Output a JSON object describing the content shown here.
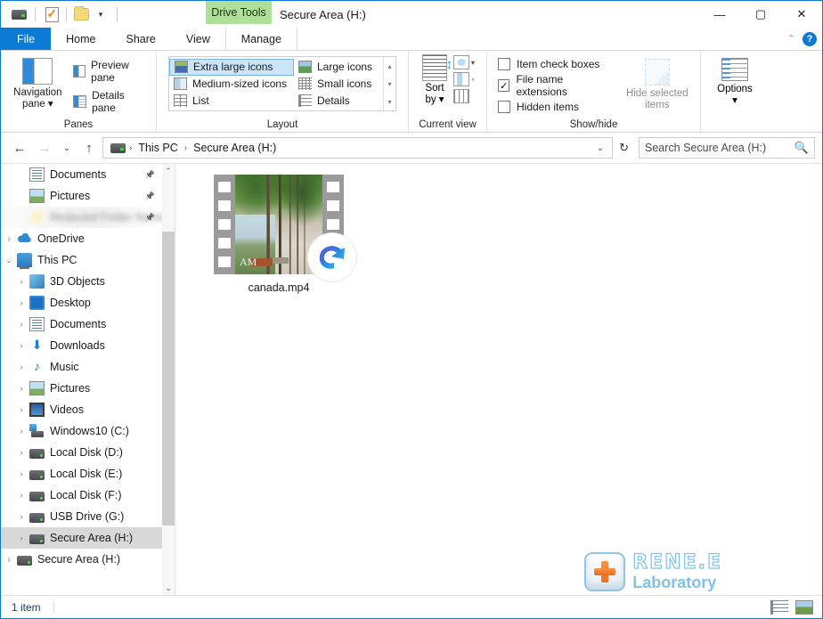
{
  "window": {
    "title": "Secure Area (H:)",
    "contextual_tab_group": "Drive Tools",
    "minimize_label": "—",
    "maximize_label": "▢",
    "close_label": "✕",
    "collapse_ribbon_label": "⌃",
    "help_label": "?"
  },
  "quick_access": {
    "items": [
      {
        "name": "drive-icon",
        "label": "Drive"
      },
      {
        "name": "properties-icon",
        "label": "Properties"
      },
      {
        "name": "new-folder-icon",
        "label": "New folder"
      },
      {
        "name": "customize-caret",
        "label": "▾"
      }
    ]
  },
  "tabs": [
    {
      "id": "file",
      "label": "File"
    },
    {
      "id": "home",
      "label": "Home"
    },
    {
      "id": "share",
      "label": "Share"
    },
    {
      "id": "view",
      "label": "View"
    },
    {
      "id": "manage",
      "label": "Manage"
    }
  ],
  "ribbon": {
    "panes": {
      "group_label": "Panes",
      "navigation_pane": "Navigation\npane",
      "navigation_pane_line1": "Navigation",
      "navigation_pane_line2": "pane ▾",
      "preview_pane": "Preview pane",
      "details_pane": "Details pane"
    },
    "layout": {
      "group_label": "Layout",
      "options": [
        {
          "label": "Extra large icons",
          "selected": true
        },
        {
          "label": "Large icons",
          "selected": false
        },
        {
          "label": "Medium-sized icons",
          "selected": false
        },
        {
          "label": "Small icons",
          "selected": false
        },
        {
          "label": "List",
          "selected": false
        },
        {
          "label": "Details",
          "selected": false
        }
      ],
      "scroll_up": "▴",
      "scroll_down": "▾",
      "expand": "▾"
    },
    "current_view": {
      "group_label": "Current view",
      "sort_by_line1": "Sort",
      "sort_by_line2": "by ▾",
      "group_by_caret": "▾",
      "add_columns_caret": "▾",
      "size_columns_caret": "▾"
    },
    "show_hide": {
      "group_label": "Show/hide",
      "checkboxes": [
        {
          "label": "Item check boxes",
          "checked": false
        },
        {
          "label": "File name extensions",
          "checked": true
        },
        {
          "label": "Hidden items",
          "checked": false
        }
      ],
      "hide_selected_line1": "Hide selected",
      "hide_selected_line2": "items"
    },
    "options": {
      "label": "Options",
      "caret": "▾"
    }
  },
  "addressbar": {
    "back": "←",
    "forward": "→",
    "recent": "⌄",
    "up": "↑",
    "breadcrumbs": [
      "This PC",
      "Secure Area (H:)"
    ],
    "separator": "›",
    "dropdown": "⌄",
    "refresh": "↻"
  },
  "search": {
    "placeholder": "Search Secure Area (H:)",
    "icon": "search-icon"
  },
  "navpane": {
    "items": [
      {
        "label": "Documents",
        "icon": "document-icon",
        "indent": 1,
        "expander": "",
        "pinned": true,
        "selected": false,
        "blurred": false
      },
      {
        "label": "Pictures",
        "icon": "picture-icon",
        "indent": 1,
        "expander": "",
        "pinned": true,
        "selected": false,
        "blurred": false
      },
      {
        "label": "Redacted Folder Name",
        "icon": "sun-icon",
        "indent": 1,
        "expander": "",
        "pinned": true,
        "selected": false,
        "blurred": true
      },
      {
        "label": "OneDrive",
        "icon": "onedrive-icon",
        "indent": 0,
        "expander": "›",
        "pinned": false,
        "selected": false,
        "blurred": false
      },
      {
        "label": "This PC",
        "icon": "this-pc-icon",
        "indent": 0,
        "expander": "⌄",
        "pinned": false,
        "selected": false,
        "blurred": false
      },
      {
        "label": "3D Objects",
        "icon": "3d-objects-icon",
        "indent": 1,
        "expander": "›",
        "pinned": false,
        "selected": false,
        "blurred": false
      },
      {
        "label": "Desktop",
        "icon": "desktop-icon",
        "indent": 1,
        "expander": "›",
        "pinned": false,
        "selected": false,
        "blurred": false
      },
      {
        "label": "Documents",
        "icon": "document-icon",
        "indent": 1,
        "expander": "›",
        "pinned": false,
        "selected": false,
        "blurred": false
      },
      {
        "label": "Downloads",
        "icon": "downloads-icon",
        "indent": 1,
        "expander": "›",
        "pinned": false,
        "selected": false,
        "blurred": false
      },
      {
        "label": "Music",
        "icon": "music-icon",
        "indent": 1,
        "expander": "›",
        "pinned": false,
        "selected": false,
        "blurred": false
      },
      {
        "label": "Pictures",
        "icon": "picture-icon",
        "indent": 1,
        "expander": "›",
        "pinned": false,
        "selected": false,
        "blurred": false
      },
      {
        "label": "Videos",
        "icon": "videos-icon",
        "indent": 1,
        "expander": "›",
        "pinned": false,
        "selected": false,
        "blurred": false
      },
      {
        "label": "Windows10 (C:)",
        "icon": "windows-drive-icon",
        "indent": 1,
        "expander": "›",
        "pinned": false,
        "selected": false,
        "blurred": false
      },
      {
        "label": "Local Disk (D:)",
        "icon": "drive-icon",
        "indent": 1,
        "expander": "›",
        "pinned": false,
        "selected": false,
        "blurred": false
      },
      {
        "label": "Local Disk (E:)",
        "icon": "drive-icon",
        "indent": 1,
        "expander": "›",
        "pinned": false,
        "selected": false,
        "blurred": false
      },
      {
        "label": "Local Disk (F:)",
        "icon": "drive-icon",
        "indent": 1,
        "expander": "›",
        "pinned": false,
        "selected": false,
        "blurred": false
      },
      {
        "label": "USB Drive (G:)",
        "icon": "drive-icon",
        "indent": 1,
        "expander": "›",
        "pinned": false,
        "selected": false,
        "blurred": false
      },
      {
        "label": "Secure Area (H:)",
        "icon": "drive-icon",
        "indent": 1,
        "expander": "›",
        "pinned": false,
        "selected": true,
        "blurred": false
      },
      {
        "label": "Secure Area (H:)",
        "icon": "drive-icon",
        "indent": 0,
        "expander": "›",
        "pinned": false,
        "selected": false,
        "blurred": false
      }
    ],
    "scroll_up": "⌃",
    "scroll_down": "⌄"
  },
  "content": {
    "files": [
      {
        "name": "canada.mp4",
        "type": "video",
        "overlay": "media-player-badge",
        "watermark": "AM"
      }
    ]
  },
  "statusbar": {
    "item_count": "1 item",
    "view_details_label": "Details view",
    "view_icons_label": "Large icons view"
  },
  "branding": {
    "name_top": "RENE.E",
    "name_bottom": "Laboratory",
    "accent": "#7fc3e8",
    "plus_color": "#ef6a1e"
  },
  "colors": {
    "window_border": "#0a7ad4",
    "file_tab": "#0a7ad4",
    "contextual_tab": "#aee09a",
    "selection": "#cce4f7",
    "navpane_selection": "#d8d8d8"
  }
}
